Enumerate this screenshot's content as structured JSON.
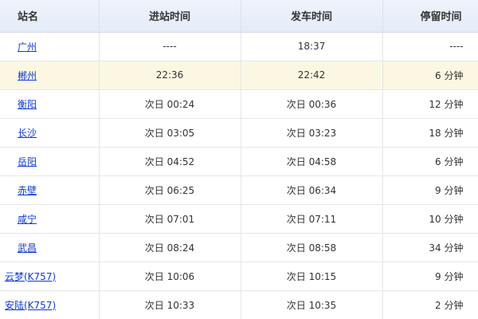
{
  "header": {
    "station": "站名",
    "arrival": "进站时间",
    "departure": "发车时间",
    "stop": "停留时间"
  },
  "rows": [
    {
      "station": "广州",
      "arrival": "----",
      "departure": "18:37",
      "stop": "----"
    },
    {
      "station": "郴州",
      "arrival": "22:36",
      "departure": "22:42",
      "stop": "6 分钟"
    },
    {
      "station": "衡阳",
      "arrival": "次日 00:24",
      "departure": "次日 00:36",
      "stop": "12 分钟"
    },
    {
      "station": "长沙",
      "arrival": "次日 03:05",
      "departure": "次日 03:23",
      "stop": "18 分钟"
    },
    {
      "station": "岳阳",
      "arrival": "次日 04:52",
      "departure": "次日 04:58",
      "stop": "6 分钟"
    },
    {
      "station": "赤壁",
      "arrival": "次日 06:25",
      "departure": "次日 06:34",
      "stop": "9 分钟"
    },
    {
      "station": "咸宁",
      "arrival": "次日 07:01",
      "departure": "次日 07:11",
      "stop": "10 分钟"
    },
    {
      "station": "武昌",
      "arrival": "次日 08:24",
      "departure": "次日 08:58",
      "stop": "34 分钟"
    },
    {
      "station": "云梦(K757)",
      "arrival": "次日 10:06",
      "departure": "次日 10:15",
      "stop": "9 分钟"
    },
    {
      "station": "安陆(K757)",
      "arrival": "次日 10:33",
      "departure": "次日 10:35",
      "stop": "2 分钟"
    }
  ],
  "colors": {
    "link": "#0c3ad8",
    "header_bg": "#e9f0fa",
    "highlight_row": "#fbf7e2"
  }
}
